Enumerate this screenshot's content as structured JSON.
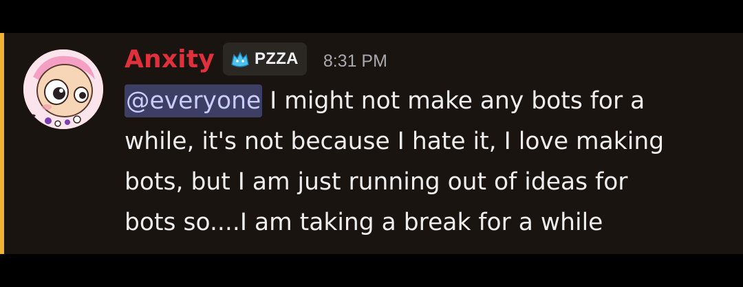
{
  "message": {
    "author": "Anxity",
    "tag": "PZZA",
    "timestamp": "8:31 PM",
    "mention": "@everyone",
    "text": " I might not make any bots for a\nwhile, it's not because I hate it, I love making\nbots, but I am just running out of ideas for\nbots so....I am taking a break for a while",
    "author_color": "#e0303b",
    "highlight_color": "#f0b232",
    "tag_icon": "blue-cat-icon",
    "avatar": "cartoon-character-avatar"
  }
}
